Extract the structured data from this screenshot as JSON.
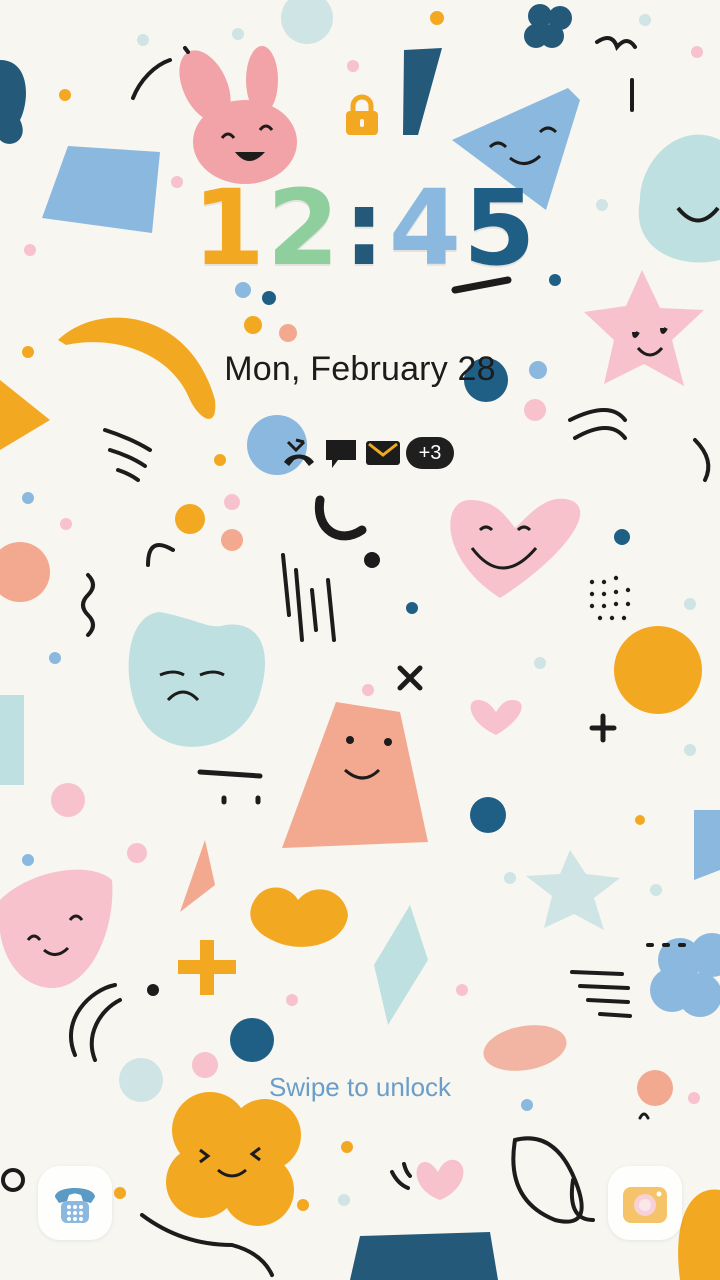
{
  "clock": {
    "digits": [
      "1",
      "2",
      ":",
      "4",
      "5"
    ],
    "digit_colors": [
      "#f3a822",
      "#8fcf9e",
      "#24597a",
      "#8ab8de",
      "#1f5f86"
    ]
  },
  "date": "Mon, February 28",
  "notifications": {
    "icons": [
      "missed-call-icon",
      "message-icon",
      "email-icon"
    ],
    "more_count": "+3"
  },
  "swipe_hint": "Swipe to unlock",
  "shortcuts": {
    "left": "phone-icon",
    "right": "camera-icon"
  },
  "colors": {
    "background": "#f7f6f0",
    "accent_orange": "#f3a822",
    "accent_blue": "#8ab8de",
    "navy": "#1f5f86",
    "pink": "#f7c2cc",
    "mint": "#bfe0e0",
    "peach": "#f2a98f"
  }
}
